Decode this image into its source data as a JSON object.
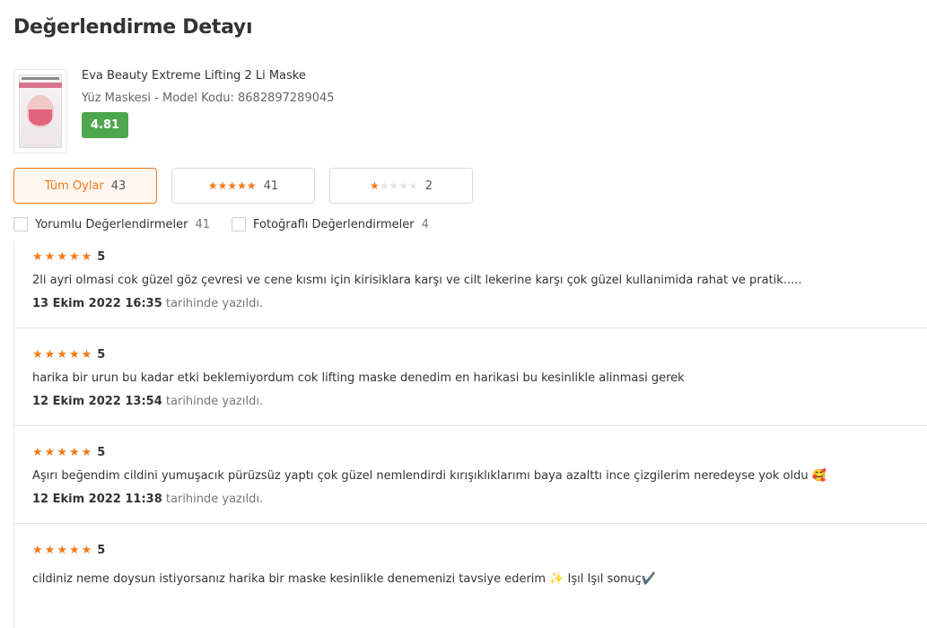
{
  "page": {
    "title": "Değerlendirme Detayı"
  },
  "product": {
    "name": "Eva Beauty Extreme Lifting 2 Li Maske",
    "meta": "Yüz Maskesi - Model Kodu: 8682897289045",
    "rating": "4.81",
    "image_icon": "product-image"
  },
  "filters": [
    {
      "label": "Tüm Oylar",
      "count": "43",
      "stars": 0,
      "active": true
    },
    {
      "label": "",
      "count": "41",
      "stars": 5,
      "active": false
    },
    {
      "label": "",
      "count": "2",
      "stars": 1,
      "active": false
    }
  ],
  "checks": [
    {
      "label": "Yorumlu Değerlendirmeler",
      "count": "41"
    },
    {
      "label": "Fotoğraflı Değerlendirmeler",
      "count": "4"
    }
  ],
  "reviews": [
    {
      "score": "5",
      "text": "2li ayri olmasi cok güzel göz çevresi ve cene kısmı için kirisiklara karşı ve cilt lekerine karşı çok güzel kullanimida rahat ve pratik.....",
      "date": "13 Ekim 2022 16:35",
      "suffix": "tarihinde yazıldı."
    },
    {
      "score": "5",
      "text": "harika bir urun bu kadar etki beklemiyordum cok lifting maske denedim en harikasi bu kesinlikle alinmasi gerek",
      "date": "12 Ekim 2022 13:54",
      "suffix": "tarihinde yazıldı."
    },
    {
      "score": "5",
      "text": "Aşırı beğendim cildini yumuşacık pürüzsüz yaptı çok güzel nemlendirdi kırışıklıklarımı baya azalttı ince çizgilerim neredeyse yok oldu 🥰",
      "date": "12 Ekim 2022 11:38",
      "suffix": "tarihinde yazıldı."
    },
    {
      "score": "5",
      "text": "cildiniz neme doysun istiyorsanız harika bir maske kesinlikle denemenizi tavsiye ederim ✨ Işıl Işıl sonuç✔️",
      "date": "",
      "suffix": ""
    }
  ],
  "colors": {
    "accent": "#f27a1a",
    "rating_badge": "#4ea64e",
    "active_bg": "#fef6ef"
  }
}
